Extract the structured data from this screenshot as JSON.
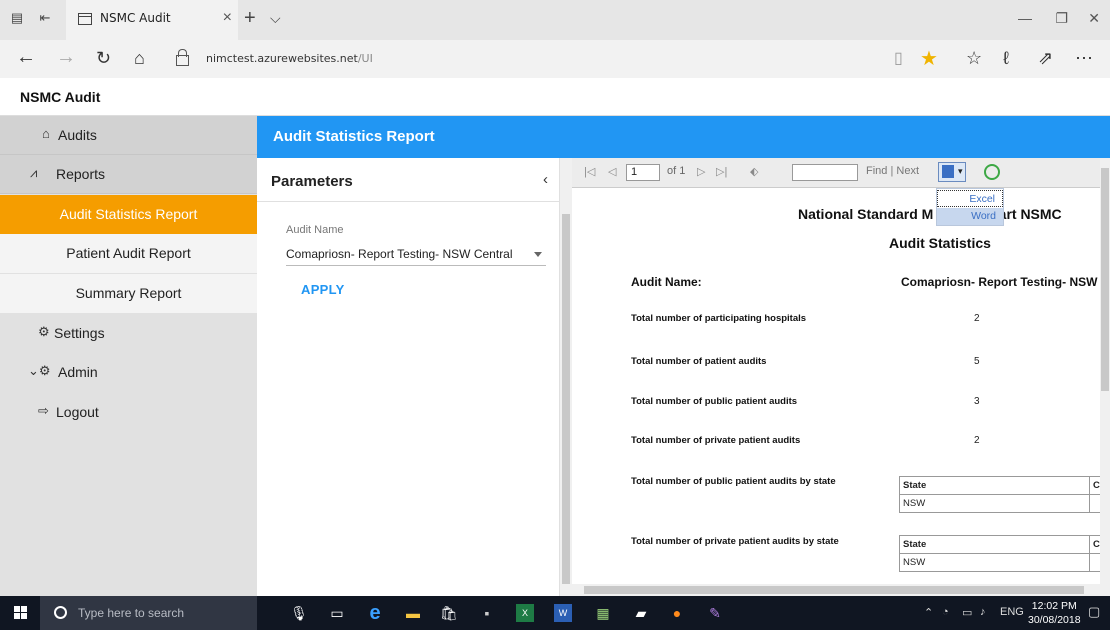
{
  "browser": {
    "tab_title": "NSMC Audit",
    "url_host": "nimctest.azurewebsites.net",
    "url_path": "/UI"
  },
  "app": {
    "title": "NSMC Audit"
  },
  "sidebar": {
    "items": [
      {
        "label": "Audits",
        "icon": "home-icon"
      },
      {
        "label": "Reports",
        "icon": "chart-line-icon"
      },
      {
        "label": "Audit Statistics Report",
        "active": true
      },
      {
        "label": "Patient Audit Report"
      },
      {
        "label": "Summary Report"
      },
      {
        "label": "Settings",
        "icon": "gears-icon"
      },
      {
        "label": "Admin",
        "icon": "admin-icon"
      },
      {
        "label": "Logout",
        "icon": "logout-icon"
      }
    ]
  },
  "main": {
    "title": "Audit Statistics Report",
    "accent_color": "#2196f3",
    "active_nav_color": "#f59d00"
  },
  "parameters": {
    "title": "Parameters",
    "collapse": "‹",
    "audit_name_label": "Audit Name",
    "audit_name_value": "Comapriosn- Report Testing- NSW Central",
    "apply_label": "APPLY"
  },
  "viewer_toolbar": {
    "page_number": "1",
    "of_pages": "of 1",
    "find_label": "Find",
    "separator": "|",
    "next_label": "Next",
    "export_options": [
      "Excel",
      "Word"
    ]
  },
  "report": {
    "title_left": "National Standard M",
    "title_right": "Chart NSMC",
    "subtitle": "Audit Statistics",
    "audit_name_label": "Audit Name:",
    "audit_name_value": "Comapriosn- Report Testing- NSW C",
    "rows": [
      {
        "label": "Total number of  participating hospitals",
        "value": "2"
      },
      {
        "label": "Total number of patient audits",
        "value": "5"
      },
      {
        "label": "Total number of public patient audits",
        "value": "3"
      },
      {
        "label": "Total number of private patient audits",
        "value": "2"
      },
      {
        "label": "Total number of public patient audits by state",
        "value": ""
      },
      {
        "label": "Total number of private patient audits by state",
        "value": ""
      }
    ],
    "public_state_table": {
      "headers": [
        "State",
        "Cc"
      ],
      "rows": [
        [
          "NSW",
          ""
        ]
      ]
    },
    "private_state_table": {
      "headers": [
        "State",
        "Cc"
      ],
      "rows": [
        [
          "NSW",
          ""
        ]
      ]
    }
  },
  "taskbar": {
    "search_placeholder": "Type here to search",
    "language": "ENG",
    "time": "12:02 PM",
    "date": "30/08/2018"
  }
}
